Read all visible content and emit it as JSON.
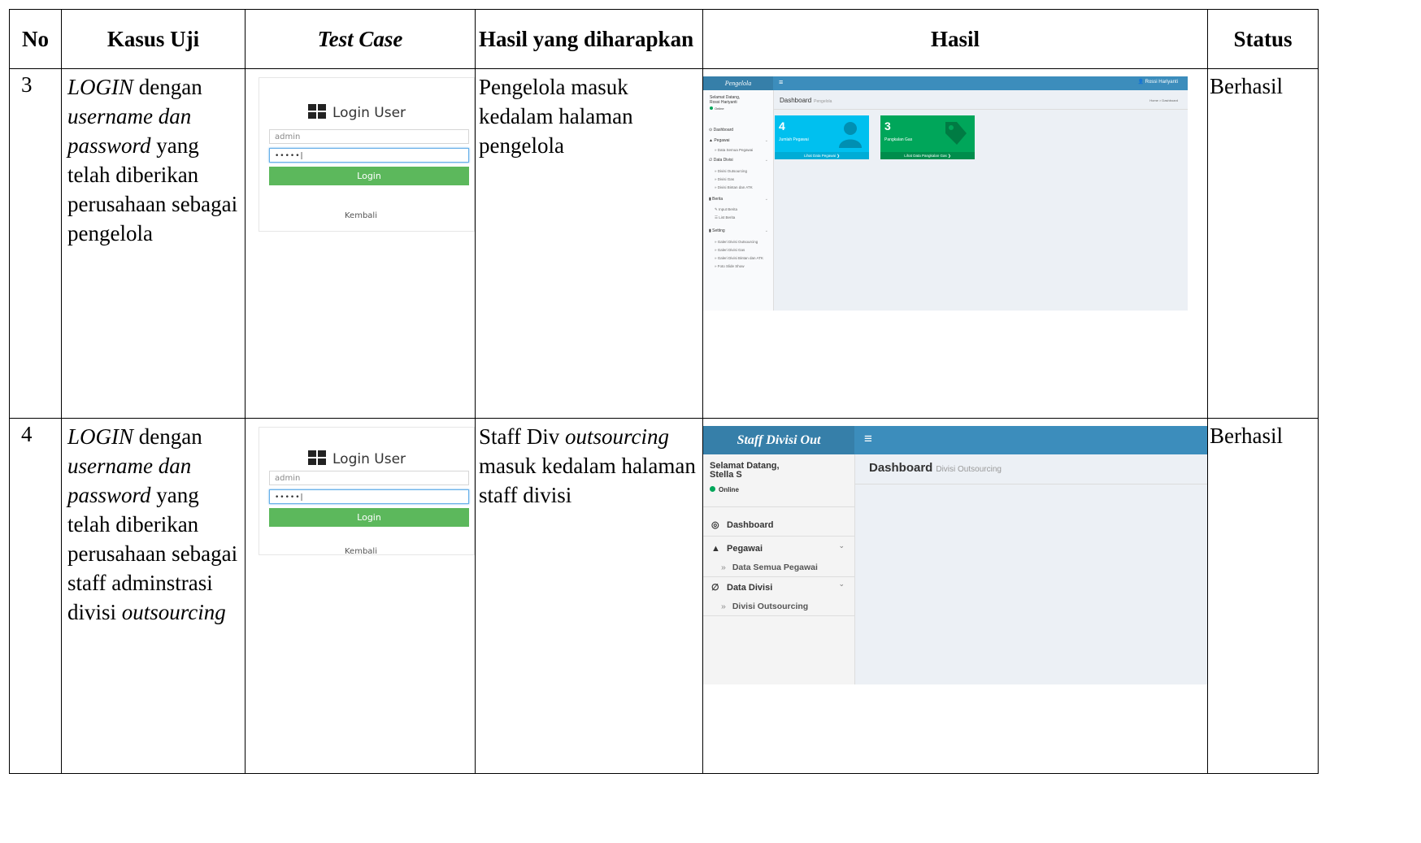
{
  "table": {
    "headers": {
      "no": "No",
      "kasus_uji": "Kasus Uji",
      "test_case": "Test Case",
      "hasil_diharapkan": "Hasil yang diharapkan",
      "hasil": "Hasil",
      "status": "Status"
    },
    "rows": [
      {
        "no": "3",
        "kasus_pre": "LOGIN",
        "kasus_mid1": " dengan ",
        "kasus_italic": "username dan password",
        "kasus_rest": " yang telah diberikan perusahaan sebagai pengelola",
        "kasus_italic_end": "",
        "expected_pre": "Pengelola masuk kedalam halaman pengelola",
        "expected_italic": "",
        "expected_rest": "",
        "status": "Berhasil"
      },
      {
        "no": "4",
        "kasus_pre": "LOGIN",
        "kasus_mid1": " dengan ",
        "kasus_italic": "username dan password",
        "kasus_rest": " yang telah diberikan perusahaan sebagai staff adminstrasi divisi ",
        "kasus_italic_end": "outsourcing",
        "expected_pre": "Staff Div ",
        "expected_italic": "outsourcing",
        "expected_rest": " masuk kedalam halaman staff divisi",
        "status": "Berhasil"
      }
    ]
  },
  "login_screen": {
    "title": "Login User",
    "username_value": "admin",
    "password_value": "•••••|",
    "login_button": "Login",
    "back_link": "Kembali"
  },
  "app_pengelola": {
    "brand": "Pengelola",
    "user_name": "Rossi Hariyanti",
    "greeting": "Selamat Datang,",
    "greeting_name": "Rossi Hariyanti",
    "online": "Online",
    "page_title": "Dashboard",
    "page_subtitle": "Pengelola",
    "breadcrumb": "Home > Dashboard",
    "menu": {
      "dashboard": "Dashboard",
      "pegawai": "Pegawai",
      "data_semua_pegawai": "Data Semua Pegawai",
      "data_divisi": "Data Divisi",
      "divisi_outsourcing": "Divisi Outsourcing",
      "divisi_gas": "Divisi Gas",
      "divisi_bintan": "Divisi Bintan dan ATK",
      "berita": "Berita",
      "input_berita": "Input Berita",
      "list_berita": "List Berita",
      "setting": "Setting",
      "galeri_outsourcing": "Galeri Divisi Outsourcing",
      "galeri_gas": "Galeri Divisi Gas",
      "galeri_bintan": "Galeri Divisi Bintan dan ATK",
      "foto_slide": "Foto Slide Show"
    },
    "boxes": [
      {
        "value": "4",
        "label": "Jumlah Pegawai",
        "footer": "Lihat Data Pegawai ❯"
      },
      {
        "value": "3",
        "label": "Pangkalan Gas",
        "footer": "Lihat Data Pangkalan Gas ❯"
      }
    ]
  },
  "app_staff": {
    "brand": "Staff Divisi Out",
    "greeting": "Selamat Datang,",
    "greeting_name": "Stella S",
    "online": "Online",
    "page_title": "Dashboard",
    "page_subtitle": "Divisi Outsourcing",
    "menu": {
      "dashboard": "Dashboard",
      "pegawai": "Pegawai",
      "data_semua_pegawai": "Data Semua Pegawai",
      "data_divisi": "Data Divisi",
      "divisi_outsourcing": "Divisi Outsourcing"
    }
  }
}
